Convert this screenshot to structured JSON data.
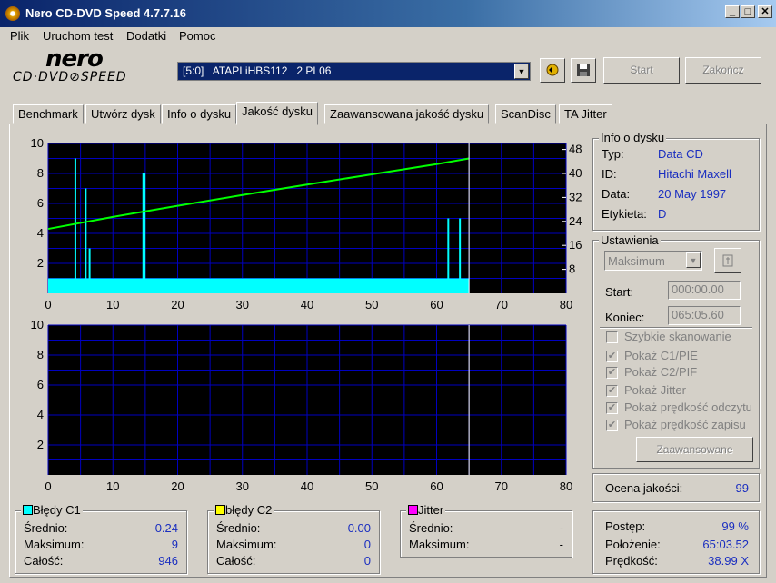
{
  "window": {
    "title": "Nero CD-DVD Speed 4.7.7.16",
    "minimize": "_",
    "maximize": "□",
    "close": "✕"
  },
  "menu": [
    "Plik",
    "Uruchom test",
    "Dodatki",
    "Pomoc"
  ],
  "logo": {
    "brand": "nero",
    "product": "CD·DVD⊘SPEED"
  },
  "toolbar": {
    "drive": "[5:0]   ATAPI iHBS112   2 PL06",
    "start_label": "Start",
    "stop_label": "Zakończ"
  },
  "tabs": [
    "Benchmark",
    "Utwórz dysk",
    "Info o dysku",
    "Jakość dysku",
    "Zaawansowana jakość dysku",
    "ScanDisc",
    "TA Jitter"
  ],
  "active_tab": "Jakość dysku",
  "disc_info": {
    "title": "Info o dysku",
    "type_label": "Typ:",
    "type_value": "Data CD",
    "id_label": "ID:",
    "id_value": "Hitachi Maxell",
    "date_label": "Data:",
    "date_value": "20 May 1997",
    "label_label": "Etykieta:",
    "label_value": "D"
  },
  "settings": {
    "title": "Ustawienia",
    "speed": "Maksimum",
    "start_label": "Start:",
    "start_value": "000:00.00",
    "end_label": "Koniec:",
    "end_value": "065:05.60",
    "options": [
      "Szybkie skanowanie",
      "Pokaż C1/PIE",
      "Pokaż C2/PIF",
      "Pokaż Jitter",
      "Pokaż prędkość odczytu",
      "Pokaż prędkość zapisu"
    ],
    "options_checked": [
      false,
      true,
      true,
      true,
      true,
      true
    ],
    "advanced_label": "Zaawansowane"
  },
  "quality": {
    "label": "Ocena jakości:",
    "value": "99"
  },
  "progress": {
    "progress_label": "Postęp:",
    "progress_value": "99 %",
    "position_label": "Położenie:",
    "position_value": "65:03.52",
    "speed_label": "Prędkość:",
    "speed_value": "38.99 X"
  },
  "c1": {
    "title": "Błędy C1",
    "color": "#00ffff",
    "avg_label": "Średnio:",
    "avg": "0.24",
    "max_label": "Maksimum:",
    "max": "9",
    "total_label": "Całość:",
    "total": "946"
  },
  "c2": {
    "title": "błędy C2",
    "color": "#ffff00",
    "avg_label": "Średnio:",
    "avg": "0.00",
    "max_label": "Maksimum:",
    "max": "0",
    "total_label": "Całość:",
    "total": "0"
  },
  "jitter": {
    "title": "Jitter",
    "color": "#ff00ff",
    "avg_label": "Średnio:",
    "avg": "-",
    "max_label": "Maksimum:",
    "max": "-"
  },
  "colors": {
    "chart_bg": "#000000",
    "grid": "#0000c0",
    "c1": "#00ffff",
    "speed": "#00ff00",
    "marker": "#ffffff"
  },
  "chart_data": [
    {
      "type": "bar",
      "x_ticks": [
        0,
        10,
        20,
        30,
        40,
        50,
        60,
        70,
        80
      ],
      "y_ticks_left": [
        2,
        4,
        6,
        8,
        10
      ],
      "y_ticks_right": [
        8,
        16,
        24,
        32,
        40,
        48
      ],
      "xlim": [
        0,
        80
      ],
      "ylim": [
        0,
        10
      ],
      "y2lim": [
        0,
        50
      ],
      "series": [
        {
          "type": "bar",
          "x": [
            4.2,
            5.8,
            6.4,
            14.7,
            14.9,
            61.8,
            63.6
          ],
          "values": [
            9,
            7,
            3,
            8,
            8,
            5,
            5
          ]
        },
        {
          "type": "line",
          "x": [
            0,
            10,
            20,
            30,
            40,
            50,
            60,
            65
          ],
          "values": [
            21.5,
            25.5,
            29.2,
            32.8,
            36.3,
            39.7,
            43.1,
            45.0
          ]
        }
      ],
      "baseline_errors": {
        "x_range": [
          0,
          65
        ],
        "value": 1
      },
      "end_marker_x": 65
    },
    {
      "type": "bar",
      "x_ticks": [
        0,
        10,
        20,
        30,
        40,
        50,
        60,
        70,
        80
      ],
      "y_ticks_left": [
        2,
        4,
        6,
        8,
        10
      ],
      "xlim": [
        0,
        80
      ],
      "ylim": [
        0,
        10
      ],
      "series": [],
      "end_marker_x": 65
    }
  ]
}
